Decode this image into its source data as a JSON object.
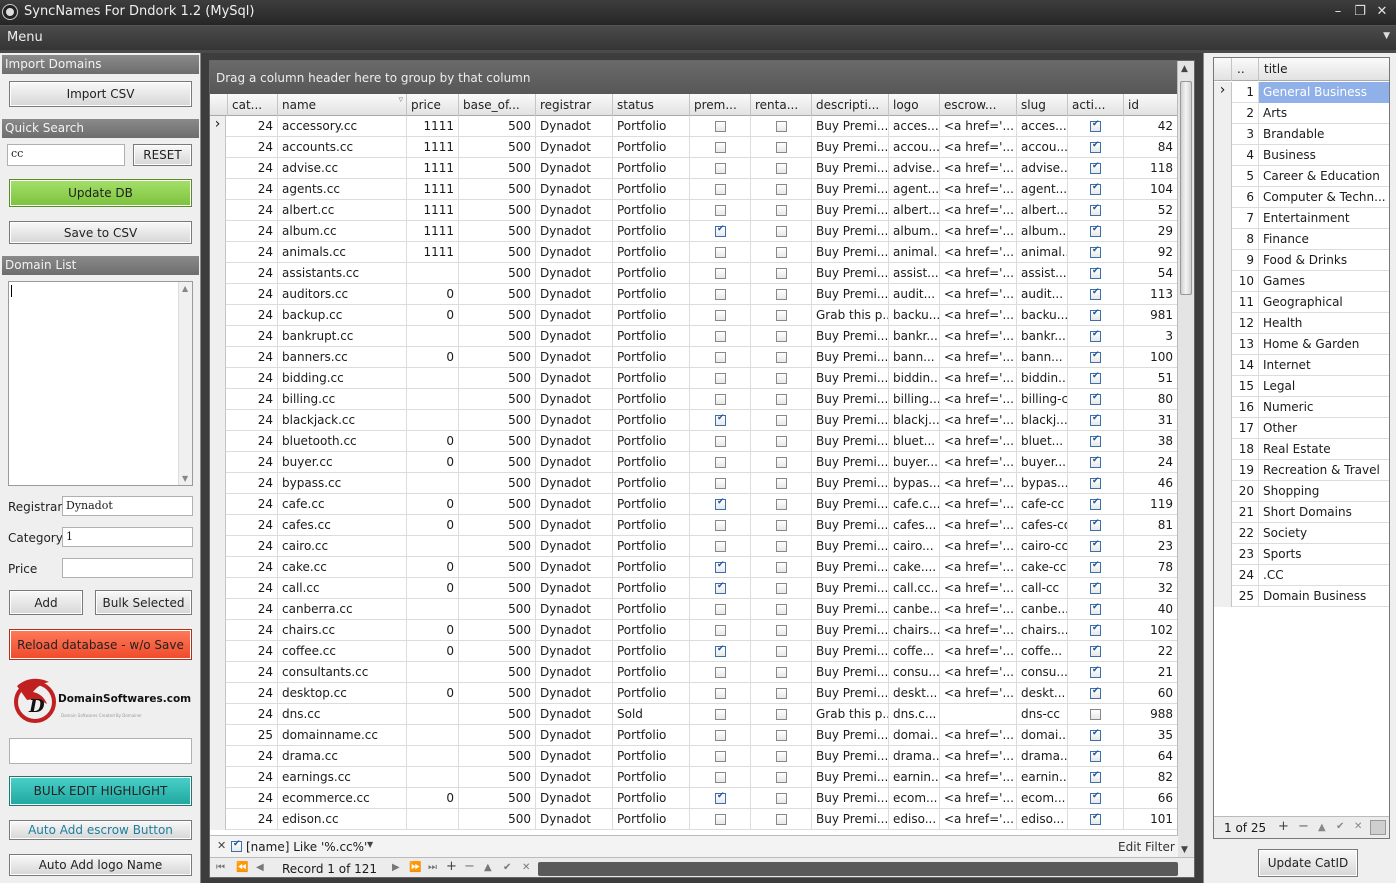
{
  "window": {
    "title": "SyncNames For Dndork  1.2 (MySql)",
    "minimize_icon": "minimize-icon",
    "restore_icon": "restore-icon",
    "close_icon": "close-icon"
  },
  "menu": {
    "label": "Menu"
  },
  "left": {
    "import_header": "Import Domains",
    "import_csv": "Import CSV",
    "quick_search_header": "Quick Search",
    "search_value": "cc",
    "reset": "RESET",
    "update_db": "Update DB",
    "save_csv": "Save to CSV",
    "domain_list_header": "Domain List",
    "registrar_label": "Registrar",
    "registrar_value": "Dynadot",
    "category_label": "Category",
    "category_value": "1",
    "price_label": "Price",
    "price_value": "",
    "add": "Add",
    "bulk_selected": "Bulk Selected",
    "reload": "Reload database - w/o Save",
    "logo_text": "DomainSoftwares.com",
    "logo_tagline": "Domain Softwares Created By Domainer",
    "bulk_edit": "BULK EDIT HIGHLIGHT",
    "auto_escrow": "Auto Add escrow Button",
    "auto_logo": "Auto Add logo Name",
    "colors": {
      "update_db": "#8fd14f",
      "reload": "#f45c3c",
      "bulk_edit": "#2bb8b0"
    }
  },
  "grid": {
    "group_hint": "Drag a column header here to group by that column",
    "columns": [
      "cat...",
      "name",
      "price",
      "base_of...",
      "registrar",
      "status",
      "prem...",
      "renta...",
      "descripti...",
      "logo",
      "escrow...",
      "slug",
      "acti...",
      "id"
    ],
    "rows": [
      {
        "cat": "24",
        "name": "accessory.cc",
        "price": "1111",
        "base": "500",
        "registrar": "Dynadot",
        "status": "Portfolio",
        "prem": false,
        "rent": false,
        "desc": "Buy Premi...",
        "logo": "acces...",
        "escrow": "<a href='...",
        "slug": "acces...",
        "active": true,
        "id": "42"
      },
      {
        "cat": "24",
        "name": "accounts.cc",
        "price": "1111",
        "base": "500",
        "registrar": "Dynadot",
        "status": "Portfolio",
        "prem": false,
        "rent": false,
        "desc": "Buy Premi...",
        "logo": "accou...",
        "escrow": "<a href='...",
        "slug": "accou...",
        "active": true,
        "id": "84"
      },
      {
        "cat": "24",
        "name": "advise.cc",
        "price": "1111",
        "base": "500",
        "registrar": "Dynadot",
        "status": "Portfolio",
        "prem": false,
        "rent": false,
        "desc": "Buy Premi...",
        "logo": "advise...",
        "escrow": "<a href='...",
        "slug": "advise...",
        "active": true,
        "id": "118"
      },
      {
        "cat": "24",
        "name": "agents.cc",
        "price": "1111",
        "base": "500",
        "registrar": "Dynadot",
        "status": "Portfolio",
        "prem": false,
        "rent": false,
        "desc": "Buy Premi...",
        "logo": "agent...",
        "escrow": "<a href='...",
        "slug": "agent...",
        "active": true,
        "id": "104"
      },
      {
        "cat": "24",
        "name": "albert.cc",
        "price": "1111",
        "base": "500",
        "registrar": "Dynadot",
        "status": "Portfolio",
        "prem": false,
        "rent": false,
        "desc": "Buy Premi...",
        "logo": "albert...",
        "escrow": "<a href='...",
        "slug": "albert...",
        "active": true,
        "id": "52"
      },
      {
        "cat": "24",
        "name": "album.cc",
        "price": "1111",
        "base": "500",
        "registrar": "Dynadot",
        "status": "Portfolio",
        "prem": true,
        "rent": false,
        "desc": "Buy Premi...",
        "logo": "album...",
        "escrow": "<a href='...",
        "slug": "album...",
        "active": true,
        "id": "29"
      },
      {
        "cat": "24",
        "name": "animals.cc",
        "price": "1111",
        "base": "500",
        "registrar": "Dynadot",
        "status": "Portfolio",
        "prem": false,
        "rent": false,
        "desc": "Buy Premi...",
        "logo": "animal...",
        "escrow": "<a href='...",
        "slug": "animal...",
        "active": true,
        "id": "92"
      },
      {
        "cat": "24",
        "name": "assistants.cc",
        "price": "",
        "base": "500",
        "registrar": "Dynadot",
        "status": "Portfolio",
        "prem": false,
        "rent": false,
        "desc": "Buy Premi...",
        "logo": "assist...",
        "escrow": "<a href='...",
        "slug": "assist...",
        "active": true,
        "id": "54"
      },
      {
        "cat": "24",
        "name": "auditors.cc",
        "price": "0",
        "base": "500",
        "registrar": "Dynadot",
        "status": "Portfolio",
        "prem": false,
        "rent": false,
        "desc": "Buy Premi...",
        "logo": "audit...",
        "escrow": "<a href='...",
        "slug": "audit...",
        "active": true,
        "id": "113"
      },
      {
        "cat": "24",
        "name": "backup.cc",
        "price": "0",
        "base": "500",
        "registrar": "Dynadot",
        "status": "Portfolio",
        "prem": false,
        "rent": false,
        "desc": "Grab this p...",
        "logo": "backu...",
        "escrow": "<a href='...",
        "slug": "backu...",
        "active": true,
        "id": "981"
      },
      {
        "cat": "24",
        "name": "bankrupt.cc",
        "price": "",
        "base": "500",
        "registrar": "Dynadot",
        "status": "Portfolio",
        "prem": false,
        "rent": false,
        "desc": "Buy Premi...",
        "logo": "bankr...",
        "escrow": "<a href='...",
        "slug": "bankr...",
        "active": true,
        "id": "3"
      },
      {
        "cat": "24",
        "name": "banners.cc",
        "price": "0",
        "base": "500",
        "registrar": "Dynadot",
        "status": "Portfolio",
        "prem": false,
        "rent": false,
        "desc": "Buy Premi...",
        "logo": "bann...",
        "escrow": "<a href='...",
        "slug": "bann...",
        "active": true,
        "id": "100"
      },
      {
        "cat": "24",
        "name": "bidding.cc",
        "price": "",
        "base": "500",
        "registrar": "Dynadot",
        "status": "Portfolio",
        "prem": false,
        "rent": false,
        "desc": "Buy Premi...",
        "logo": "biddin...",
        "escrow": "<a href='...",
        "slug": "biddin...",
        "active": true,
        "id": "51"
      },
      {
        "cat": "24",
        "name": "billing.cc",
        "price": "",
        "base": "500",
        "registrar": "Dynadot",
        "status": "Portfolio",
        "prem": false,
        "rent": false,
        "desc": "Buy Premi...",
        "logo": "billing...",
        "escrow": "<a href='...",
        "slug": "billing-cc",
        "active": true,
        "id": "80"
      },
      {
        "cat": "24",
        "name": "blackjack.cc",
        "price": "",
        "base": "500",
        "registrar": "Dynadot",
        "status": "Portfolio",
        "prem": true,
        "rent": false,
        "desc": "Buy Premi...",
        "logo": "blackj...",
        "escrow": "<a href='...",
        "slug": "blackj...",
        "active": true,
        "id": "31"
      },
      {
        "cat": "24",
        "name": "bluetooth.cc",
        "price": "0",
        "base": "500",
        "registrar": "Dynadot",
        "status": "Portfolio",
        "prem": false,
        "rent": false,
        "desc": "Buy Premi...",
        "logo": "bluet...",
        "escrow": "<a href='...",
        "slug": "bluet...",
        "active": true,
        "id": "38"
      },
      {
        "cat": "24",
        "name": "buyer.cc",
        "price": "0",
        "base": "500",
        "registrar": "Dynadot",
        "status": "Portfolio",
        "prem": false,
        "rent": false,
        "desc": "Buy Premi...",
        "logo": "buyer...",
        "escrow": "<a href='...",
        "slug": "buyer...",
        "active": true,
        "id": "24"
      },
      {
        "cat": "24",
        "name": "bypass.cc",
        "price": "",
        "base": "500",
        "registrar": "Dynadot",
        "status": "Portfolio",
        "prem": false,
        "rent": false,
        "desc": "Buy Premi...",
        "logo": "bypas...",
        "escrow": "<a href='...",
        "slug": "bypas...",
        "active": true,
        "id": "46"
      },
      {
        "cat": "24",
        "name": "cafe.cc",
        "price": "0",
        "base": "500",
        "registrar": "Dynadot",
        "status": "Portfolio",
        "prem": true,
        "rent": false,
        "desc": "Buy Premi...",
        "logo": "cafe.c...",
        "escrow": "<a href='...",
        "slug": "cafe-cc",
        "active": true,
        "id": "119"
      },
      {
        "cat": "24",
        "name": "cafes.cc",
        "price": "0",
        "base": "500",
        "registrar": "Dynadot",
        "status": "Portfolio",
        "prem": false,
        "rent": false,
        "desc": "Buy Premi...",
        "logo": "cafes...",
        "escrow": "<a href='...",
        "slug": "cafes-cc",
        "active": true,
        "id": "81"
      },
      {
        "cat": "24",
        "name": "cairo.cc",
        "price": "",
        "base": "500",
        "registrar": "Dynadot",
        "status": "Portfolio",
        "prem": false,
        "rent": false,
        "desc": "Buy Premi...",
        "logo": "cairo...",
        "escrow": "<a href='...",
        "slug": "cairo-cc",
        "active": true,
        "id": "23"
      },
      {
        "cat": "24",
        "name": "cake.cc",
        "price": "0",
        "base": "500",
        "registrar": "Dynadot",
        "status": "Portfolio",
        "prem": true,
        "rent": false,
        "desc": "Buy Premi...",
        "logo": "cake....",
        "escrow": "<a href='...",
        "slug": "cake-cc",
        "active": true,
        "id": "78"
      },
      {
        "cat": "24",
        "name": "call.cc",
        "price": "0",
        "base": "500",
        "registrar": "Dynadot",
        "status": "Portfolio",
        "prem": true,
        "rent": false,
        "desc": "Buy Premi...",
        "logo": "call.cc...",
        "escrow": "<a href='...",
        "slug": "call-cc",
        "active": true,
        "id": "32"
      },
      {
        "cat": "24",
        "name": "canberra.cc",
        "price": "",
        "base": "500",
        "registrar": "Dynadot",
        "status": "Portfolio",
        "prem": false,
        "rent": false,
        "desc": "Buy Premi...",
        "logo": "canbe...",
        "escrow": "<a href='...",
        "slug": "canbe...",
        "active": true,
        "id": "40"
      },
      {
        "cat": "24",
        "name": "chairs.cc",
        "price": "0",
        "base": "500",
        "registrar": "Dynadot",
        "status": "Portfolio",
        "prem": false,
        "rent": false,
        "desc": "Buy Premi...",
        "logo": "chairs...",
        "escrow": "<a href='...",
        "slug": "chairs...",
        "active": true,
        "id": "102"
      },
      {
        "cat": "24",
        "name": "coffee.cc",
        "price": "0",
        "base": "500",
        "registrar": "Dynadot",
        "status": "Portfolio",
        "prem": true,
        "rent": false,
        "desc": "Buy Premi...",
        "logo": "coffe...",
        "escrow": "<a href='...",
        "slug": "coffe...",
        "active": true,
        "id": "22"
      },
      {
        "cat": "24",
        "name": "consultants.cc",
        "price": "",
        "base": "500",
        "registrar": "Dynadot",
        "status": "Portfolio",
        "prem": false,
        "rent": false,
        "desc": "Buy Premi...",
        "logo": "consu...",
        "escrow": "<a href='...",
        "slug": "consu...",
        "active": true,
        "id": "21"
      },
      {
        "cat": "24",
        "name": "desktop.cc",
        "price": "0",
        "base": "500",
        "registrar": "Dynadot",
        "status": "Portfolio",
        "prem": false,
        "rent": false,
        "desc": "Buy Premi...",
        "logo": "deskt...",
        "escrow": "<a href='...",
        "slug": "deskt...",
        "active": true,
        "id": "60"
      },
      {
        "cat": "24",
        "name": "dns.cc",
        "price": "",
        "base": "500",
        "registrar": "Dynadot",
        "status": "Sold",
        "prem": false,
        "rent": false,
        "desc": "Grab this p...",
        "logo": "dns.c...",
        "escrow": "",
        "slug": "dns-cc",
        "active": false,
        "id": "988"
      },
      {
        "cat": "25",
        "name": "domainname.cc",
        "price": "",
        "base": "500",
        "registrar": "Dynadot",
        "status": "Portfolio",
        "prem": false,
        "rent": false,
        "desc": "Buy Premi...",
        "logo": "domai...",
        "escrow": "<a href='...",
        "slug": "domai...",
        "active": true,
        "id": "35"
      },
      {
        "cat": "24",
        "name": "drama.cc",
        "price": "",
        "base": "500",
        "registrar": "Dynadot",
        "status": "Portfolio",
        "prem": false,
        "rent": false,
        "desc": "Buy Premi...",
        "logo": "drama...",
        "escrow": "<a href='...",
        "slug": "drama...",
        "active": true,
        "id": "64"
      },
      {
        "cat": "24",
        "name": "earnings.cc",
        "price": "",
        "base": "500",
        "registrar": "Dynadot",
        "status": "Portfolio",
        "prem": false,
        "rent": false,
        "desc": "Buy Premi...",
        "logo": "earnin...",
        "escrow": "<a href='...",
        "slug": "earnin...",
        "active": true,
        "id": "82"
      },
      {
        "cat": "24",
        "name": "ecommerce.cc",
        "price": "0",
        "base": "500",
        "registrar": "Dynadot",
        "status": "Portfolio",
        "prem": true,
        "rent": false,
        "desc": "Buy Premi...",
        "logo": "ecom...",
        "escrow": "<a href='...",
        "slug": "ecom...",
        "active": true,
        "id": "66"
      },
      {
        "cat": "24",
        "name": "edison.cc",
        "price": "",
        "base": "500",
        "registrar": "Dynadot",
        "status": "Portfolio",
        "prem": false,
        "rent": false,
        "desc": "Buy Premi...",
        "logo": "ediso...",
        "escrow": "<a href='...",
        "slug": "ediso...",
        "active": true,
        "id": "101"
      }
    ],
    "filter_text": "[name] Like '%.cc%'",
    "edit_filter": "Edit Filter",
    "record_text": "Record 1 of 121"
  },
  "categories": {
    "header_id": "..",
    "header_title": "title",
    "items": [
      {
        "id": "1",
        "title": "General Business"
      },
      {
        "id": "2",
        "title": "Arts"
      },
      {
        "id": "3",
        "title": "Brandable"
      },
      {
        "id": "4",
        "title": "Business"
      },
      {
        "id": "5",
        "title": "Career & Education"
      },
      {
        "id": "6",
        "title": "Computer & Techn..."
      },
      {
        "id": "7",
        "title": "Entertainment"
      },
      {
        "id": "8",
        "title": "Finance"
      },
      {
        "id": "9",
        "title": "Food & Drinks"
      },
      {
        "id": "10",
        "title": "Games"
      },
      {
        "id": "11",
        "title": "Geographical"
      },
      {
        "id": "12",
        "title": "Health"
      },
      {
        "id": "13",
        "title": "Home & Garden"
      },
      {
        "id": "14",
        "title": "Internet"
      },
      {
        "id": "15",
        "title": "Legal"
      },
      {
        "id": "16",
        "title": "Numeric"
      },
      {
        "id": "17",
        "title": "Other"
      },
      {
        "id": "18",
        "title": "Real Estate"
      },
      {
        "id": "19",
        "title": "Recreation & Travel"
      },
      {
        "id": "20",
        "title": "Shopping"
      },
      {
        "id": "21",
        "title": "Short Domains"
      },
      {
        "id": "22",
        "title": "Society"
      },
      {
        "id": "23",
        "title": "Sports"
      },
      {
        "id": "24",
        "title": ".CC"
      },
      {
        "id": "25",
        "title": "Domain Business"
      }
    ],
    "pager_text": "1 of 25",
    "update_catid": "Update CatID",
    "selected_color": "#8fb0e8"
  }
}
